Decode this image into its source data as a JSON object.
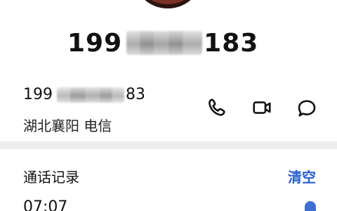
{
  "header": {
    "number_prefix": "199",
    "number_suffix": "183"
  },
  "contact": {
    "number_prefix": "199",
    "number_suffix": "83",
    "location": "湖北襄阳 电信",
    "actions": [
      {
        "name": "phone-icon"
      },
      {
        "name": "video-call-icon"
      },
      {
        "name": "message-icon"
      }
    ]
  },
  "records": {
    "title": "通话记录",
    "clear_label": "清空",
    "items": [
      {
        "time": "07:07"
      }
    ]
  },
  "colors": {
    "accent": "#2a5fcc",
    "divider": "#eeeeee"
  }
}
